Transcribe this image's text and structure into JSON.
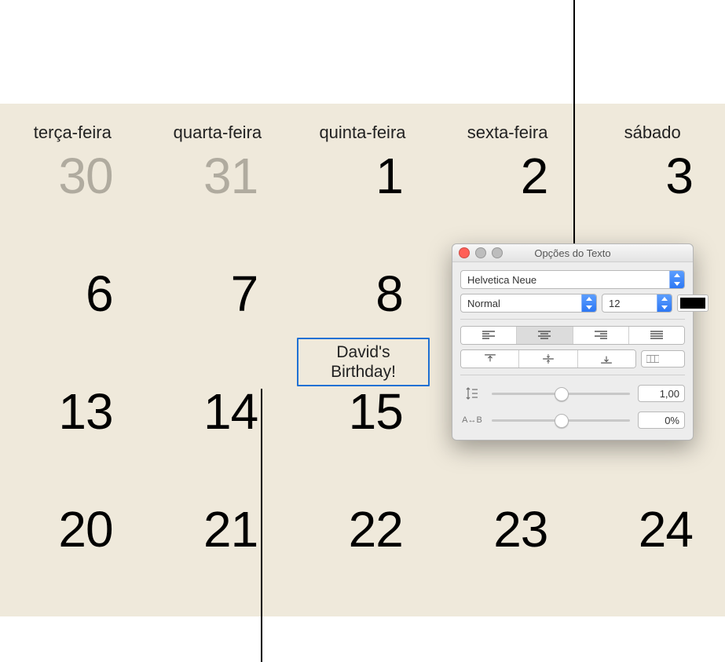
{
  "calendar": {
    "day_headers": [
      "terça-feira",
      "quarta-feira",
      "quinta-feira",
      "sexta-feira",
      "sábado"
    ],
    "rows": [
      [
        {
          "n": "30",
          "faded": true
        },
        {
          "n": "31",
          "faded": true
        },
        {
          "n": "1",
          "faded": false
        },
        {
          "n": "2",
          "faded": false
        },
        {
          "n": "3",
          "faded": false
        }
      ],
      [
        {
          "n": "6",
          "faded": false
        },
        {
          "n": "7",
          "faded": false
        },
        {
          "n": "8",
          "faded": false
        },
        {
          "n": "",
          "faded": false
        },
        {
          "n": "",
          "faded": false
        }
      ],
      [
        {
          "n": "13",
          "faded": false
        },
        {
          "n": "14",
          "faded": false
        },
        {
          "n": "15",
          "faded": false
        },
        {
          "n": "",
          "faded": false
        },
        {
          "n": "",
          "faded": false
        }
      ],
      [
        {
          "n": "20",
          "faded": false
        },
        {
          "n": "21",
          "faded": false
        },
        {
          "n": "22",
          "faded": false
        },
        {
          "n": "23",
          "faded": false
        },
        {
          "n": "24",
          "faded": false
        }
      ]
    ],
    "event_line1": "David's",
    "event_line2": "Birthday!"
  },
  "text_options": {
    "window_title": "Opções do Texto",
    "font": "Helvetica Neue",
    "style": "Normal",
    "size": "12",
    "color": "#000000",
    "line_spacing_value": "1,00",
    "tracking_value": "0%"
  }
}
